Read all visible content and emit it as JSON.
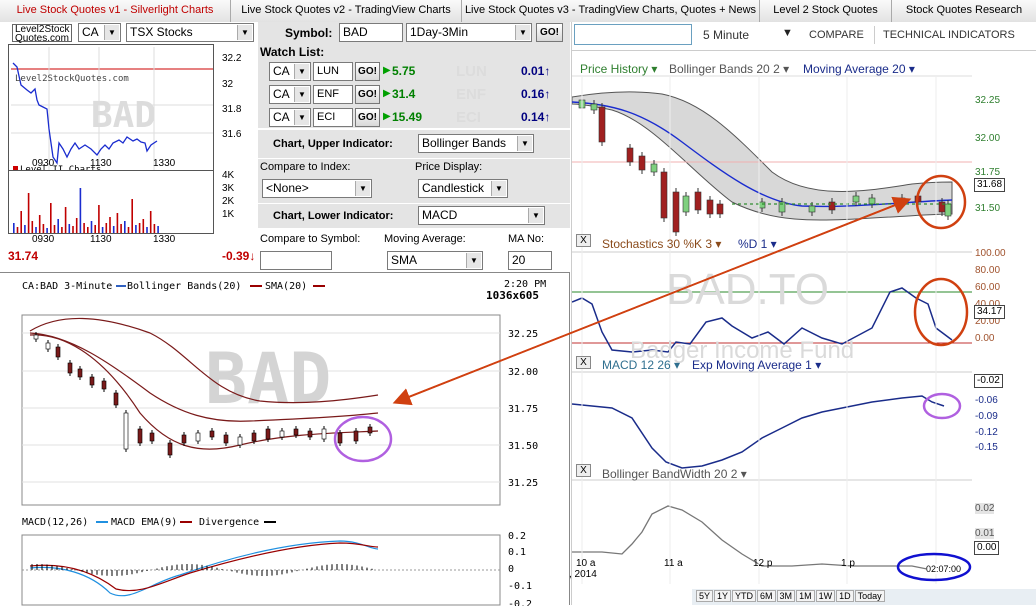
{
  "tabs": [
    {
      "label": "Live Stock Quotes v1 - Silverlight Charts",
      "active": true
    },
    {
      "label": "Live Stock Quotes v2 - TradingView Charts",
      "active": false
    },
    {
      "label": "Live Stock Quotes v3 - TradingView Charts, Quotes + News",
      "active": false
    },
    {
      "label": "Level 2 Stock Quotes",
      "active": false
    },
    {
      "label": "Stock Quotes Research",
      "active": false
    }
  ],
  "logo": {
    "line1": "Level2Stock",
    "line2": "Quotes.com"
  },
  "market_select": "CA",
  "exchange_select": "TSX Stocks",
  "symbol": {
    "label": "Symbol:",
    "value": "BAD",
    "period": "1Day-3Min",
    "go": "GO!"
  },
  "mini_chart": {
    "watermark": "BAD",
    "site": "Level2StockQuotes.com",
    "legend": "Level II Charts",
    "y_labels": [
      "32.2",
      "32",
      "31.8",
      "31.6"
    ],
    "x_labels": [
      "0930",
      "1130",
      "1330"
    ],
    "vol_labels": [
      "4K",
      "3K",
      "2K",
      "1K"
    ],
    "price": "31.74",
    "change": "-0.39"
  },
  "watchlist": {
    "title": "Watch List:",
    "items": [
      {
        "market": "CA",
        "symbol": "LUN",
        "go": "GO!",
        "price": "5.75",
        "ticker": "LUN",
        "change": "0.01"
      },
      {
        "market": "CA",
        "symbol": "ENF",
        "go": "GO!",
        "price": "31.4",
        "ticker": "ENF",
        "change": "0.16"
      },
      {
        "market": "CA",
        "symbol": "ECI",
        "go": "GO!",
        "price": "15.49",
        "ticker": "ECI",
        "change": "0.14"
      }
    ]
  },
  "settings": {
    "upper_label": "Chart, Upper Indicator:",
    "upper_value": "Bollinger Bands",
    "compare_index_label": "Compare to Index:",
    "compare_index_value": "<None>",
    "price_display_label": "Price Display:",
    "price_display_value": "Candlestick",
    "lower_label": "Chart, Lower Indicator:",
    "lower_value": "MACD",
    "compare_symbol_label": "Compare to Symbol:",
    "compare_symbol_value": "",
    "ma_label": "Moving Average:",
    "ma_value": "SMA",
    "ma_no_label": "MA No:",
    "ma_no_value": "20"
  },
  "main_chart": {
    "legend": [
      "CA:BAD 3-Minute",
      "Bollinger Bands(20)",
      "SMA(20)"
    ],
    "time": "2:20 PM",
    "size_label": "1036x605",
    "watermark": "BAD",
    "y_labels": [
      "32.25",
      "32.00",
      "31.75",
      "31.50",
      "31.25"
    ],
    "macd_legend": [
      "MACD(12,26)",
      "MACD EMA(9)",
      "Divergence"
    ],
    "macd_labels": [
      "0.2",
      "0.1",
      "0",
      "-0.1",
      "-0.2"
    ]
  },
  "right": {
    "search_placeholder": "",
    "interval": "5 Minute",
    "compare": "COMPARE",
    "technical": "TECHNICAL INDICATORS",
    "price_pane": {
      "titles": [
        "Price History ▾",
        "Bollinger Bands 20 2 ▾",
        "Moving Average 20 ▾"
      ],
      "y_labels": [
        "32.25",
        "32.00",
        "31.75",
        "31.50"
      ],
      "last": "31.68"
    },
    "watermark": "BAD.TO",
    "company": "Badger Income Fund",
    "stoch_pane": {
      "close": "X",
      "titles": [
        "Stochastics 30 %K 3 ▾",
        "%D 1 ▾"
      ],
      "y_labels": [
        "100.00",
        "80.00",
        "60.00",
        "40.00",
        "20.00",
        "0.00"
      ],
      "last": "34.17"
    },
    "macd_pane": {
      "close": "X",
      "titles": [
        "MACD 12 26 ▾",
        "Exp Moving Average 1 ▾"
      ],
      "y_labels": [
        "-0.06",
        "-0.09",
        "-0.12",
        "-0.15"
      ],
      "last": "-0.02"
    },
    "bbw_pane": {
      "close": "X",
      "titles": [
        "Bollinger BandWidth 20 2 ▾"
      ],
      "y_labels": [
        "0.02",
        "0.01"
      ],
      "last": "0.00"
    },
    "x_labels": [
      "10 a",
      "11 a",
      "12 p",
      "1 p"
    ],
    "date_label": ", 2014",
    "time_label": "02:07:00",
    "range_buttons": [
      "5Y",
      "1Y",
      "YTD",
      "6M",
      "3M",
      "1M",
      "1W",
      "1D",
      "Today"
    ]
  },
  "colors": {
    "tab_active": "#c00000",
    "price_up": "#008000",
    "change_down": "#c00000",
    "macd_line": "#1a2c8a",
    "annotation_orange": "#d04010",
    "annotation_purple": "#b060e0",
    "annotation_blue": "#1010d0"
  }
}
